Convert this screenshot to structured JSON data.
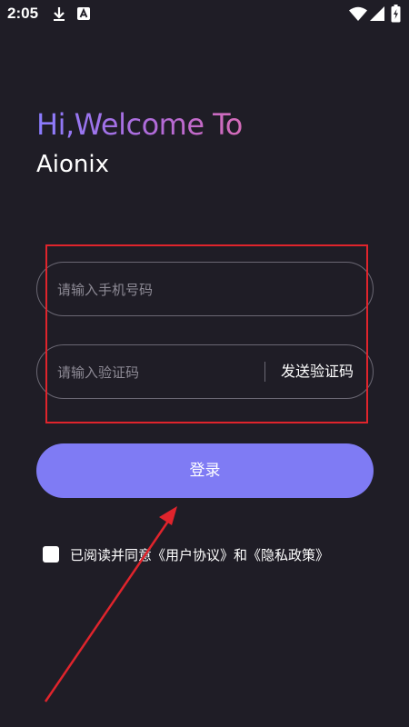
{
  "status_bar": {
    "time": "2:05",
    "icons": [
      "download-icon",
      "a-badge-icon",
      "wifi-icon",
      "signal-icon",
      "battery-charging-icon"
    ]
  },
  "header": {
    "greeting": "Hi,Welcome To",
    "app_name": "Aionix"
  },
  "form": {
    "phone_placeholder": "请输入手机号码",
    "phone_value": "",
    "code_placeholder": "请输入验证码",
    "code_value": "",
    "send_code_label": "发送验证码",
    "login_label": "登录"
  },
  "agreement": {
    "checked": false,
    "text": "已阅读并同意《用户协议》和《隐私政策》"
  },
  "colors": {
    "background": "#1f1d26",
    "accent": "#7f7bf4",
    "annotation": "#e0242c"
  }
}
